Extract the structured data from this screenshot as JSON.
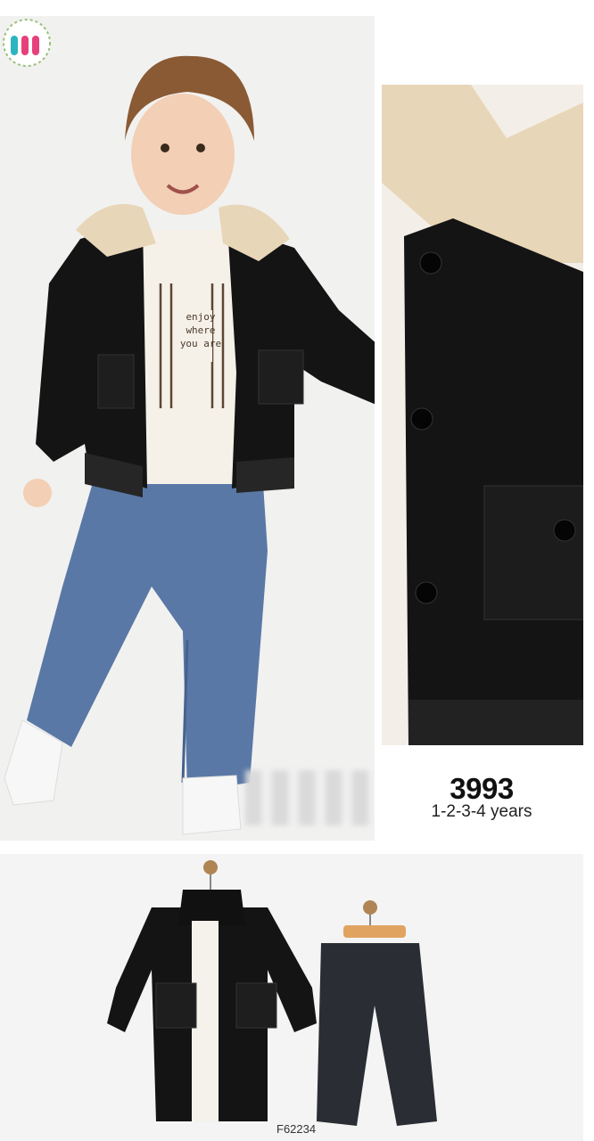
{
  "product": {
    "code": "3993",
    "sizes": "1-2-3-4 years",
    "sku": "F62234"
  },
  "tshirt_print": [
    "enjoy",
    "where",
    "you are"
  ],
  "colors": {
    "jacket": "#141414",
    "collar": "#e8d6b8",
    "tshirt": "#f6f1e8",
    "jeans": "#5a78a6",
    "dark_jeans": "#2a2d33",
    "skin": "#f2cfb5",
    "hair": "#8a5a34",
    "logo_pink": "#e6417b",
    "logo_teal": "#2bb5c0"
  }
}
